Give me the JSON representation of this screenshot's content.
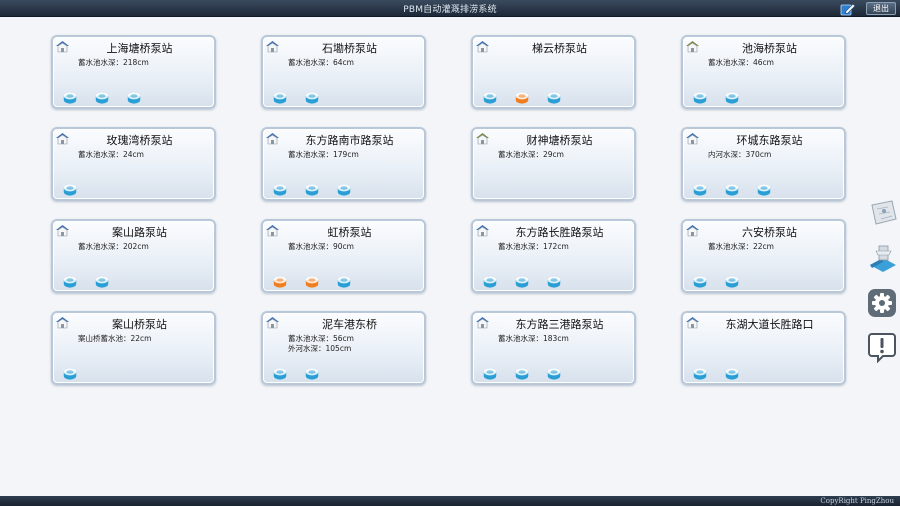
{
  "header": {
    "title": "PBM自动灌溉排涝系统",
    "exit_label": "退出"
  },
  "footer": {
    "copyright": "CopyRight PingZhou"
  },
  "colors": {
    "pump_running": "#f07d1e",
    "pump_idle": "#2a9fd6",
    "house_roof_normal": "#3d6fb3",
    "house_roof_alt": "#7b8a3c"
  },
  "stations": [
    {
      "name": "上海塘桥泵站",
      "readings": [
        "蓄水池水深：218cm"
      ],
      "roof": "normal",
      "pumps": [
        "idle",
        "idle",
        "idle"
      ]
    },
    {
      "name": "石墈桥泵站",
      "readings": [
        "蓄水池水深：64cm"
      ],
      "roof": "normal",
      "pumps": [
        "idle",
        "idle"
      ]
    },
    {
      "name": "梯云桥泵站",
      "readings": [],
      "roof": "normal",
      "pumps": [
        "idle",
        "running",
        "idle"
      ]
    },
    {
      "name": "池海桥泵站",
      "readings": [
        "蓄水池水深：46cm"
      ],
      "roof": "alt",
      "pumps": [
        "idle",
        "idle"
      ]
    },
    {
      "name": "玫瑰湾桥泵站",
      "readings": [
        "蓄水池水深：24cm"
      ],
      "roof": "normal",
      "pumps": [
        "idle"
      ]
    },
    {
      "name": "东方路南市路泵站",
      "readings": [
        "蓄水池水深：179cm"
      ],
      "roof": "normal",
      "pumps": [
        "idle",
        "idle",
        "idle"
      ]
    },
    {
      "name": "财神塘桥泵站",
      "readings": [
        "蓄水池水深：29cm"
      ],
      "roof": "alt",
      "pumps": []
    },
    {
      "name": "环城东路泵站",
      "readings": [
        "内河水深：370cm"
      ],
      "roof": "normal",
      "pumps": [
        "idle",
        "idle",
        "idle"
      ]
    },
    {
      "name": "案山路泵站",
      "readings": [
        "蓄水池水深：202cm"
      ],
      "roof": "normal",
      "pumps": [
        "idle",
        "idle"
      ]
    },
    {
      "name": "虹桥泵站",
      "readings": [
        "蓄水池水深：90cm"
      ],
      "roof": "normal",
      "pumps": [
        "running",
        "running",
        "idle"
      ]
    },
    {
      "name": "东方路长胜路泵站",
      "readings": [
        "蓄水池水深：172cm"
      ],
      "roof": "normal",
      "pumps": [
        "idle",
        "idle",
        "idle"
      ]
    },
    {
      "name": "六安桥泵站",
      "readings": [
        "蓄水池水深：22cm"
      ],
      "roof": "normal",
      "pumps": [
        "idle",
        "idle"
      ]
    },
    {
      "name": "案山桥泵站",
      "readings": [
        "案山桥蓄水池：22cm"
      ],
      "roof": "normal",
      "pumps": [
        "idle"
      ]
    },
    {
      "name": "泥车港东桥",
      "readings": [
        "蓄水池水深：56cm",
        "外河水深：105cm"
      ],
      "roof": "normal",
      "pumps": [
        "idle",
        "idle"
      ]
    },
    {
      "name": "东方路三港路泵站",
      "readings": [
        "蓄水池水深：183cm"
      ],
      "roof": "normal",
      "pumps": [
        "idle",
        "idle",
        "idle"
      ]
    },
    {
      "name": "东湖大道长胜路口",
      "readings": [],
      "roof": "normal",
      "pumps": [
        "idle",
        "idle"
      ]
    }
  ],
  "sidebar": {
    "tools": [
      "map-icon",
      "pump-control-icon",
      "gear-icon",
      "alert-icon"
    ]
  }
}
